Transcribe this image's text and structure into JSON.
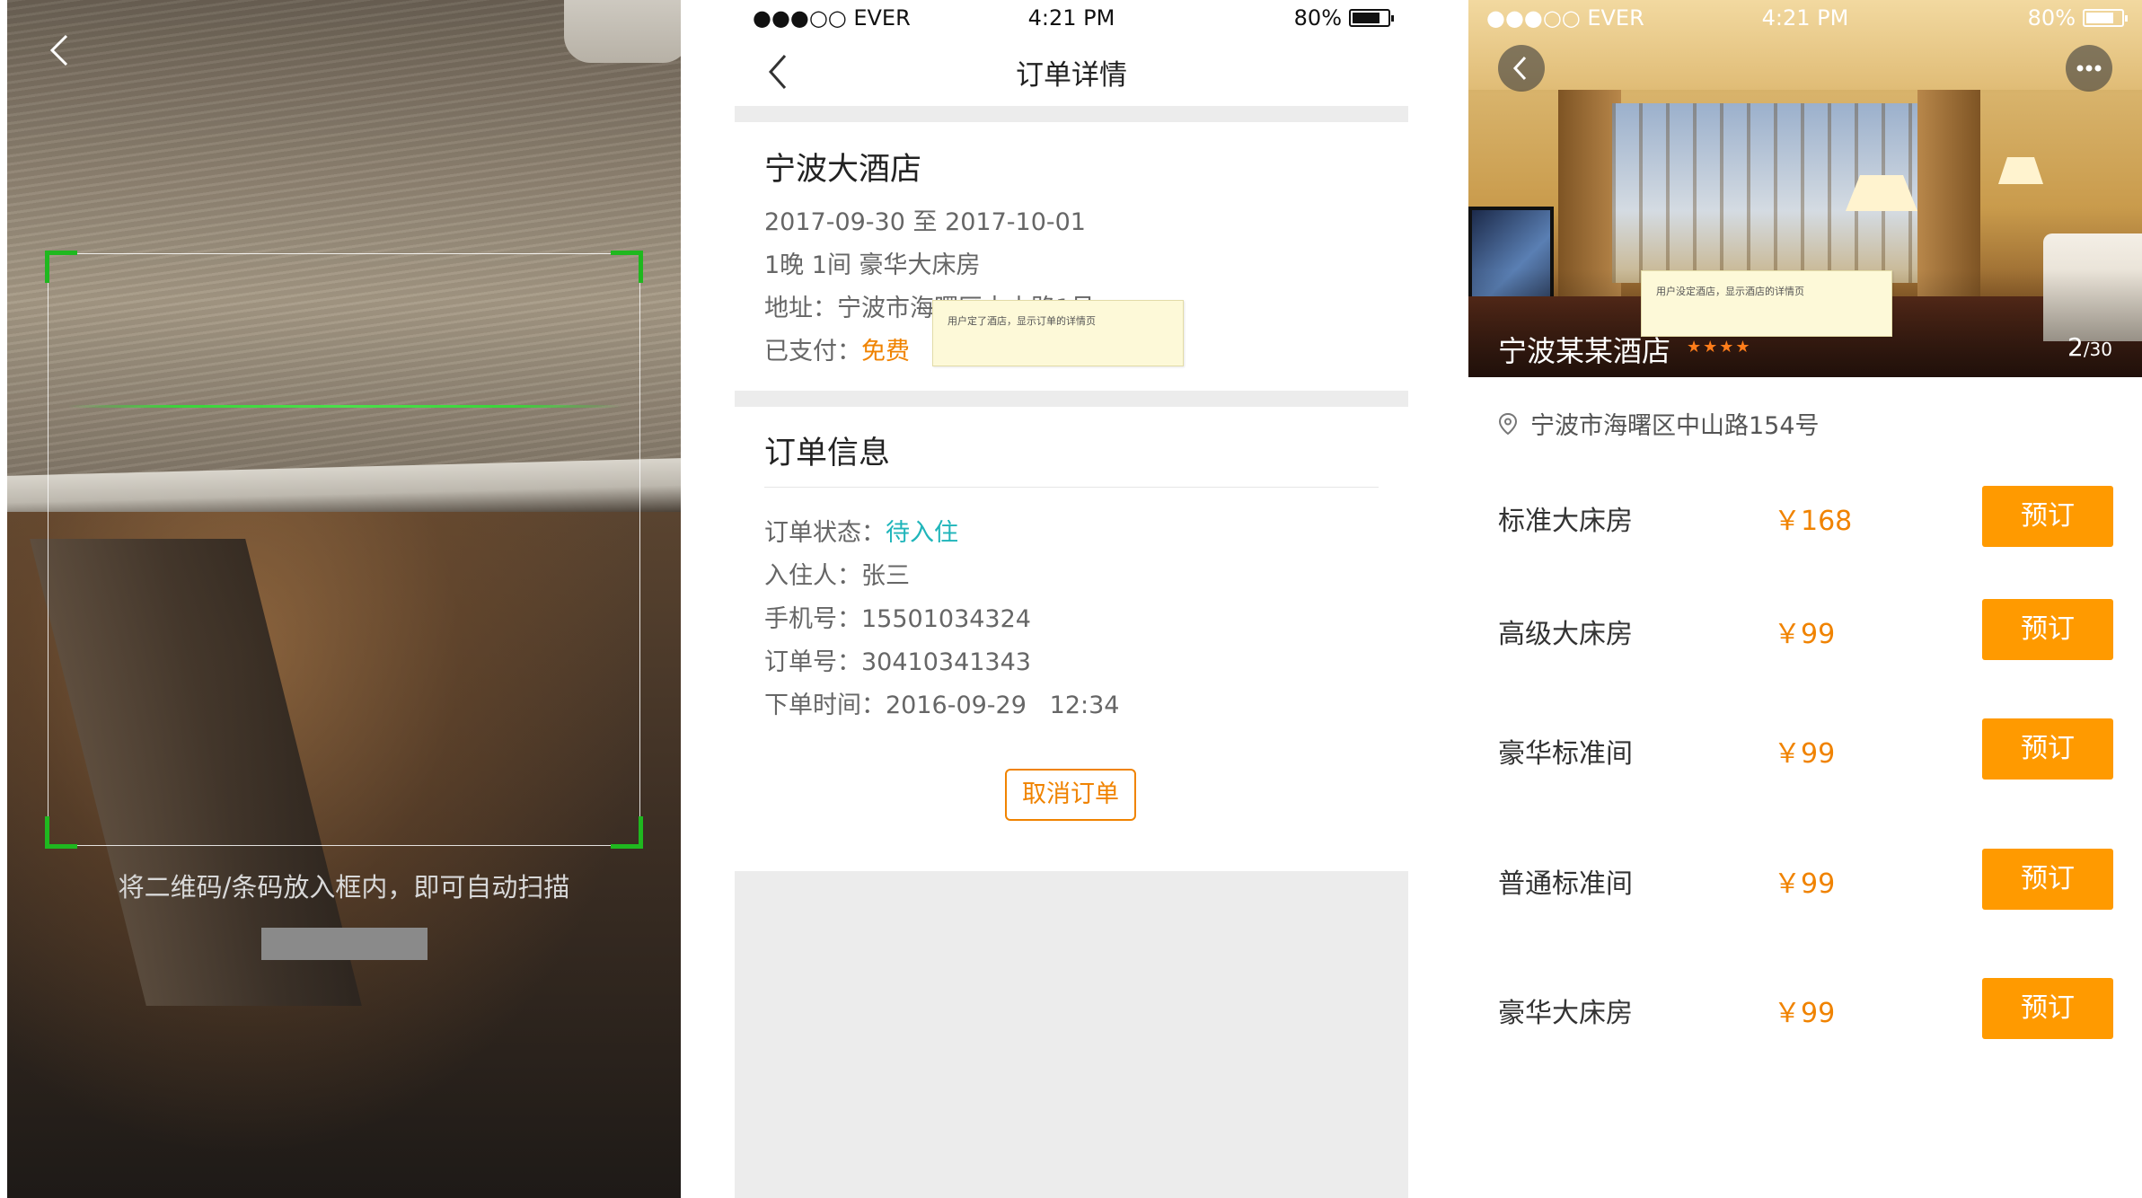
{
  "scanner": {
    "hint": "将二维码/条码放入框内，即可自动扫描"
  },
  "statusbar": {
    "carrier": "●●●○○ EVER",
    "time": "4:21 PM",
    "battery": "80%",
    "battery_level": 0.8
  },
  "order": {
    "nav_title": "订单详情",
    "hotel_name": "宁波大酒店",
    "dates": "2017-09-30 至 2017-10-01",
    "room_summary": "1晚 1间 豪华大床房",
    "address_label": "地址：",
    "address": "宁波市海曙区中山路1号",
    "paid_label": "已支付：",
    "paid_value": "免费",
    "note": "用户定了酒店，显示订单的详情页",
    "info_title": "订单信息",
    "status_label": "订单状态：",
    "status_value": "待入住",
    "guest_label": "入住人：",
    "guest_value": "张三",
    "phone_label": "手机号：",
    "phone_value": "15501034324",
    "orderno_label": "订单号：",
    "orderno_value": "30410341343",
    "time_label": "下单时间：",
    "time_value": "2016-09-29   12:34",
    "cancel_label": "取消订单"
  },
  "hotel": {
    "name": "宁波某某酒店",
    "stars": "★★★★",
    "photo_index": "2",
    "photo_total": "/30",
    "note": "用户没定酒店，显示酒店的详情页",
    "address": "宁波市海曙区中山路154号",
    "rooms": [
      {
        "name": "标准大床房",
        "price": "￥168",
        "button": "预订"
      },
      {
        "name": "高级大床房",
        "price": "￥99",
        "button": "预订"
      },
      {
        "name": "豪华标准间",
        "price": "￥99",
        "button": "预订"
      },
      {
        "name": "普通标准间",
        "price": "￥99",
        "button": "预订"
      },
      {
        "name": "豪华大床房",
        "price": "￥99",
        "button": "预订"
      }
    ]
  },
  "colors": {
    "accent_orange": "#f08300",
    "button_orange": "#ff9a00",
    "status_teal": "#1fb5ba",
    "scan_green": "#1fb81f"
  }
}
